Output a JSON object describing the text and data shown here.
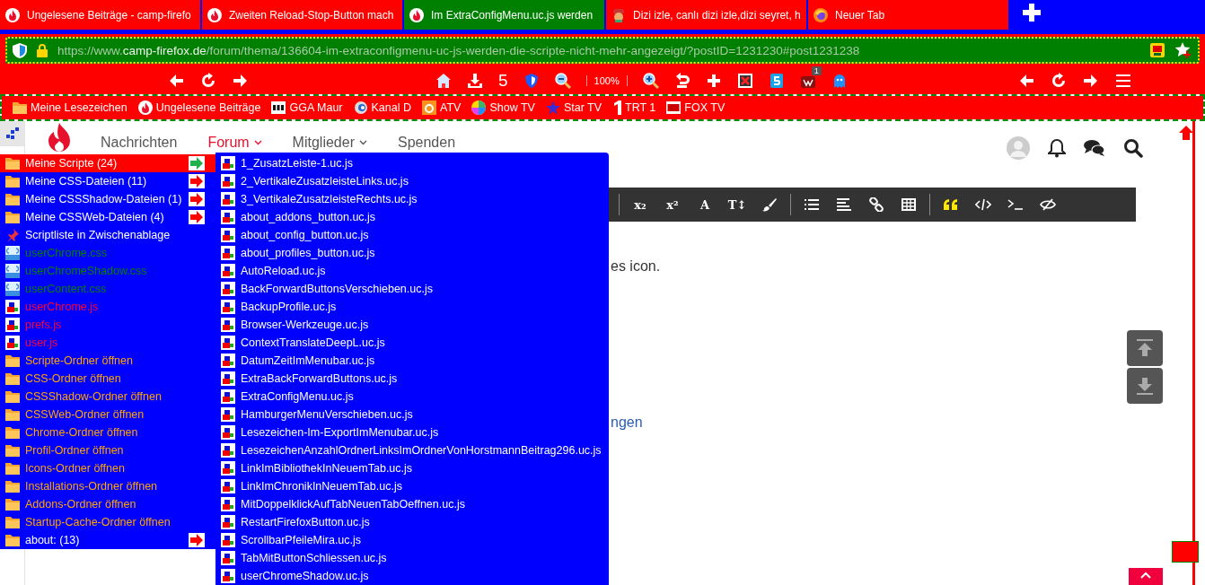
{
  "tabs": [
    {
      "title": "Ungelesene Beiträge - camp-firefo",
      "kind": "flame",
      "selected": false
    },
    {
      "title": "Zweiten Reload-Stop-Button mach",
      "kind": "flame",
      "selected": false
    },
    {
      "title": "Im ExtraConfigMenu.uc.js werden",
      "kind": "flame",
      "selected": true
    },
    {
      "title": "Dizi izle, canlı dizi izle,dizi seyret, h",
      "kind": "mascot",
      "selected": false
    },
    {
      "title": "Neuer Tab",
      "kind": "firefox",
      "selected": false
    }
  ],
  "url": {
    "prefix": "https://www.",
    "domain": "camp-firefox.de",
    "path": "/forum/thema/136604-im-extraconfigmenu-uc-js-werden-die-scripte-nicht-mehr-angezeigt/?postID=1231230#post1231238"
  },
  "toolbar": {
    "counter": "5",
    "zoom": "100%",
    "badge": "1"
  },
  "bookmarks": [
    {
      "label": "Meine Lesezeichen",
      "kind": "folder"
    },
    {
      "label": "Ungelesene Beiträge",
      "kind": "flame"
    },
    {
      "label": "GGA Maur",
      "kind": "gga"
    },
    {
      "label": "Kanal D",
      "kind": "kanal"
    },
    {
      "label": "ATV",
      "kind": "atv"
    },
    {
      "label": "Show TV",
      "kind": "showtv"
    },
    {
      "label": "Star TV",
      "kind": "startv"
    },
    {
      "label": "TRT 1",
      "kind": "trt"
    },
    {
      "label": "FOX TV",
      "kind": "fox"
    }
  ],
  "nav": [
    {
      "label": "Nachrichten",
      "dropdown": false,
      "selected": false
    },
    {
      "label": "Forum",
      "dropdown": true,
      "selected": true
    },
    {
      "label": "Mitglieder",
      "dropdown": true,
      "selected": false
    },
    {
      "label": "Spenden",
      "dropdown": false,
      "selected": false
    }
  ],
  "editor_tools": [
    {
      "kind": "separator"
    },
    {
      "kind": "glyph",
      "label": "x₂"
    },
    {
      "kind": "glyph",
      "label": "x²"
    },
    {
      "kind": "glyph",
      "label": "A"
    },
    {
      "kind": "glyph",
      "label": "T↕"
    },
    {
      "kind": "brush"
    },
    {
      "kind": "separator"
    },
    {
      "kind": "list"
    },
    {
      "kind": "align"
    },
    {
      "kind": "link"
    },
    {
      "kind": "table"
    },
    {
      "kind": "separator"
    },
    {
      "kind": "quote"
    },
    {
      "kind": "code"
    },
    {
      "kind": "terminal"
    },
    {
      "kind": "hidden"
    }
  ],
  "post_text": "es icon.",
  "post_link": "ngen",
  "menu": [
    {
      "label": "Meine Scripte (24)",
      "kind": "folder",
      "color": "#ffffff",
      "submenu": true,
      "selected": true
    },
    {
      "label": "Meine CSS-Dateien (11)",
      "kind": "folder",
      "color": "#ffffff",
      "submenu": true,
      "selected": false
    },
    {
      "label": "Meine CSSShadow-Dateien (1)",
      "kind": "folder",
      "color": "#ffffff",
      "submenu": true,
      "selected": false
    },
    {
      "label": "Meine CSSWeb-Dateien (4)",
      "kind": "folder",
      "color": "#ffffff",
      "submenu": true,
      "selected": false
    },
    {
      "label": "Scriptliste in Zwischenablage",
      "kind": "pin",
      "color": "#ffffff",
      "submenu": false,
      "selected": false
    },
    {
      "label": "userChrome.css",
      "kind": "css",
      "color": "#008000",
      "submenu": false,
      "selected": false
    },
    {
      "label": "userChromeShadow.css",
      "kind": "css",
      "color": "#008000",
      "submenu": false,
      "selected": false
    },
    {
      "label": "userContent.css",
      "kind": "css",
      "color": "#008000",
      "submenu": false,
      "selected": false
    },
    {
      "label": "userChrome.js",
      "kind": "js",
      "color": "#ff0033",
      "submenu": false,
      "selected": false
    },
    {
      "label": "prefs.js",
      "kind": "js",
      "color": "#ff0033",
      "submenu": false,
      "selected": false
    },
    {
      "label": "user.js",
      "kind": "js",
      "color": "#ff0033",
      "submenu": false,
      "selected": false
    },
    {
      "label": "Scripte-Ordner öffnen",
      "kind": "folder",
      "color": "#ffa500",
      "submenu": false,
      "selected": false
    },
    {
      "label": "CSS-Ordner öffnen",
      "kind": "folder",
      "color": "#ffa500",
      "submenu": false,
      "selected": false
    },
    {
      "label": "CSSShadow-Ordner öffnen",
      "kind": "folder",
      "color": "#ffa500",
      "submenu": false,
      "selected": false
    },
    {
      "label": "CSSWeb-Ordner öffnen",
      "kind": "folder",
      "color": "#ffa500",
      "submenu": false,
      "selected": false
    },
    {
      "label": "Chrome-Ordner öffnen",
      "kind": "folder",
      "color": "#ffa500",
      "submenu": false,
      "selected": false
    },
    {
      "label": "Profil-Ordner öffnen",
      "kind": "folder",
      "color": "#ffa500",
      "submenu": false,
      "selected": false
    },
    {
      "label": "Icons-Ordner öffnen",
      "kind": "folder",
      "color": "#ffa500",
      "submenu": false,
      "selected": false
    },
    {
      "label": "Installations-Ordner öffnen",
      "kind": "folder",
      "color": "#ffa500",
      "submenu": false,
      "selected": false
    },
    {
      "label": "Addons-Ordner öffnen",
      "kind": "folder",
      "color": "#ffa500",
      "submenu": false,
      "selected": false
    },
    {
      "label": "Startup-Cache-Ordner öffnen",
      "kind": "folder",
      "color": "#ffa500",
      "submenu": false,
      "selected": false
    },
    {
      "label": "about: (13)",
      "kind": "folder",
      "color": "#ffffff",
      "submenu": true,
      "selected": false
    }
  ],
  "submenu": [
    "1_ZusatzLeiste-1.uc.js",
    "2_VertikaleZusatzleisteLinks.uc.js",
    "3_VertikaleZusatzleisteRechts.uc.js",
    "about_addons_button.uc.js",
    "about_config_button.uc.js",
    "about_profiles_button.uc.js",
    "AutoReload.uc.js",
    "BackForwardButtonsVerschieben.uc.js",
    "BackupProfile.uc.js",
    "Browser-Werkzeuge.uc.js",
    "ContextTranslateDeepL.uc.js",
    "DatumZeitImMenubar.uc.js",
    "ExtraBackForwardButtons.uc.js",
    "ExtraConfigMenu.uc.js",
    "HamburgerMenuVerschieben.uc.js",
    "Lesezeichen-Im-ExportImMenubar.uc.js",
    "LesezeichenAnzahlOrdnerLinksImOrdnerVonHorstmannBeitrag296.uc.js",
    "LinkImBibliothekInNeuemTab.uc.js",
    "LinkImChronikInNeuemTab.uc.js",
    "MitDoppelklickAufTabNeuenTabOeffnen.uc.js",
    "RestartFirefoxButton.uc.js",
    "ScrollbarPfeileMira.uc.js",
    "TabMitButtonSchliessen.uc.js",
    "userChromeShadow.uc.js"
  ]
}
